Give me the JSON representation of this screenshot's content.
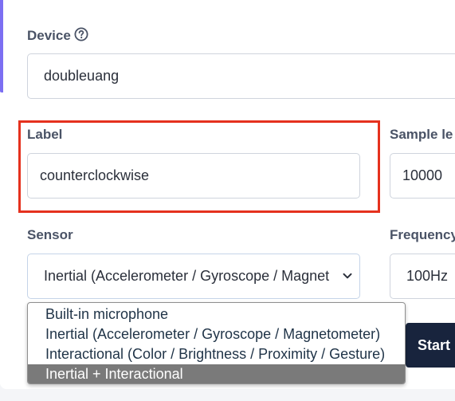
{
  "form": {
    "device": {
      "label": "Device",
      "help_icon": "question-circle-icon",
      "value": "doubleuang"
    },
    "label_field": {
      "label": "Label",
      "value": "counterclockwise"
    },
    "sample_length": {
      "label": "Sample le",
      "value": "10000"
    },
    "sensor": {
      "label": "Sensor",
      "selected_text": "Inertial (Accelerometer / Gyroscope / Magnet",
      "chevron_icon": "chevron-down-icon",
      "options": [
        "Built-in microphone",
        "Inertial (Accelerometer / Gyroscope / Magnetometer)",
        "Interactional (Color / Brightness / Proximity / Gesture)",
        "Inertial + Interactional"
      ],
      "highlighted_option_index": 3
    },
    "frequency": {
      "label": "Frequency",
      "value": "100Hz"
    },
    "start_button_label": "Start"
  },
  "colors": {
    "accent": "#7c6ff2",
    "highlight": "#e5311e",
    "button_bg": "#18243d",
    "label_text": "#4a5366",
    "option_hover": "#7a7a7a"
  }
}
